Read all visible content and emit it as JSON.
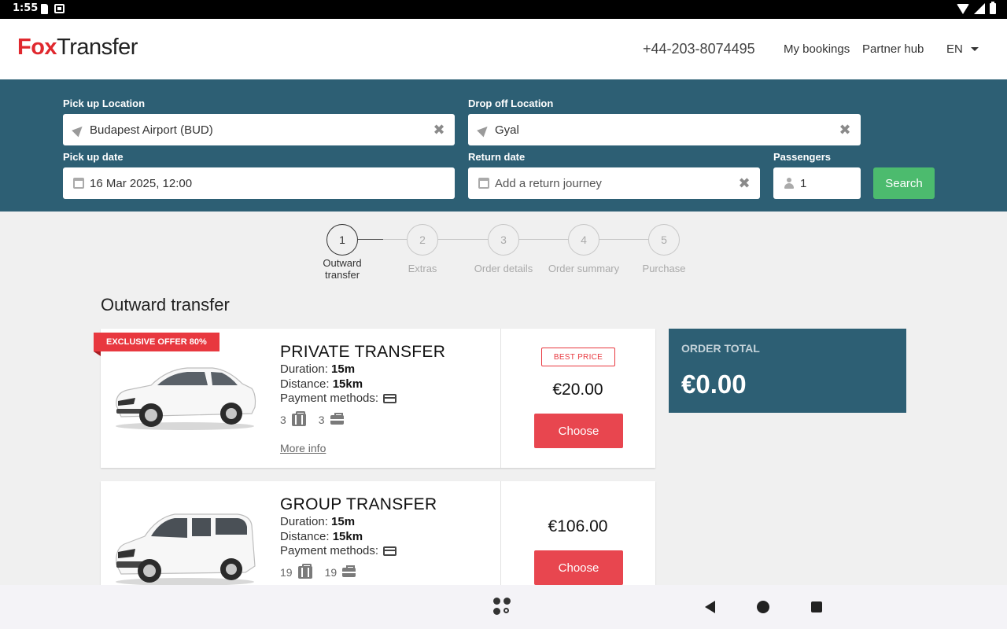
{
  "status_bar": {
    "time": "1:55"
  },
  "header": {
    "logo_part1": "Fox",
    "logo_part2": "Transfer",
    "phone": "+44-203-8074495",
    "nav": {
      "bookings": "My bookings",
      "partner": "Partner hub"
    },
    "language": "EN"
  },
  "search": {
    "pickup_label": "Pick up Location",
    "pickup_value": "Budapest Airport (BUD)",
    "dropoff_label": "Drop off Location",
    "dropoff_value": "Gyal",
    "pickup_date_label": "Pick up date",
    "pickup_date_value": "16 Mar 2025, 12:00",
    "return_label": "Return date",
    "return_placeholder": "Add a return journey",
    "passengers_label": "Passengers",
    "passengers_value": "1",
    "search_button": "Search"
  },
  "steps": [
    {
      "number": "1",
      "label": "Outward transfer"
    },
    {
      "number": "2",
      "label": "Extras"
    },
    {
      "number": "3",
      "label": "Order details"
    },
    {
      "number": "4",
      "label": "Order summary"
    },
    {
      "number": "5",
      "label": "Purchase"
    }
  ],
  "section_title": "Outward transfer",
  "transfers": [
    {
      "ribbon": "EXCLUSIVE OFFER 80%",
      "title": "PRIVATE TRANSFER",
      "duration_label": "Duration:",
      "duration": "15m",
      "distance_label": "Distance:",
      "distance": "15km",
      "payment_label": "Payment methods:",
      "luggage": "3",
      "hand_luggage": "3",
      "more_info": "More info",
      "badge": "BEST PRICE",
      "price": "€20.00",
      "choose": "Choose"
    },
    {
      "title": "GROUP TRANSFER",
      "duration_label": "Duration:",
      "duration": "15m",
      "distance_label": "Distance:",
      "distance": "15km",
      "payment_label": "Payment methods:",
      "luggage": "19",
      "hand_luggage": "19",
      "price": "€106.00",
      "choose": "Choose"
    }
  ],
  "order_total": {
    "label": "ORDER TOTAL",
    "value": "€0.00"
  }
}
